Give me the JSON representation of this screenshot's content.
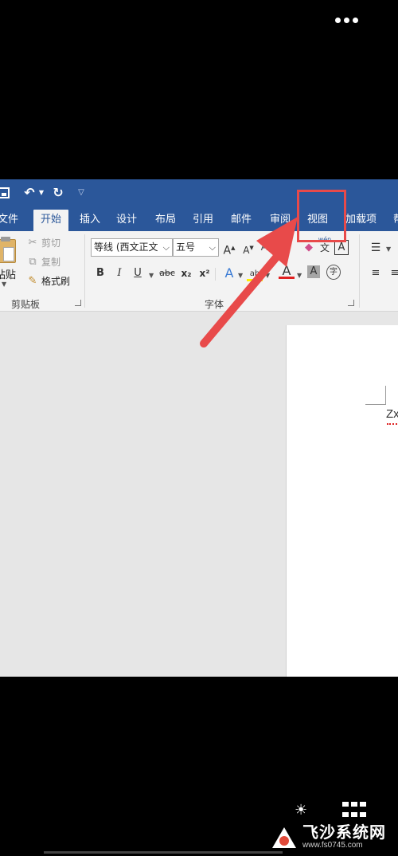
{
  "overlay": {
    "more_icon": "more-dots-icon",
    "highlight_color": "#e84a4a",
    "arrow_color": "#e84a4a"
  },
  "colors": {
    "word_blue": "#2b579a",
    "ribbon_bg": "#f3f3f3",
    "doc_bg": "#e6e6e6"
  },
  "qat": {
    "save_icon": "save-icon",
    "undo_icon": "undo-icon",
    "redo_icon": "redo-icon",
    "customize_icon": "customize-qat-icon"
  },
  "tabs": [
    {
      "label": "文件"
    },
    {
      "label": "开始",
      "active": true
    },
    {
      "label": "插入"
    },
    {
      "label": "设计"
    },
    {
      "label": "布局"
    },
    {
      "label": "引用"
    },
    {
      "label": "邮件"
    },
    {
      "label": "审阅"
    },
    {
      "label": "视图"
    },
    {
      "label": "加载项"
    },
    {
      "label": "帮"
    }
  ],
  "clipboard": {
    "paste": "粘贴",
    "cut": "剪切",
    "copy": "复制",
    "format_painter": "格式刷",
    "group": "剪贴板"
  },
  "font": {
    "name": "等线 (西文正文",
    "size": "五号",
    "group": "字体",
    "grow": "A",
    "shrink": "A",
    "bold": "B",
    "italic": "I",
    "underline": "U",
    "strike": "abc",
    "sub": "x₂",
    "sup": "x²",
    "effects": "A",
    "color": "A",
    "shade": "A",
    "phonetic": "文",
    "phonetic_top": "wén",
    "border": "A",
    "enclose": "字"
  },
  "document": {
    "text": "Zx"
  },
  "watermark": {
    "title": "飞沙系统网",
    "url": "www.fs0745.com"
  }
}
